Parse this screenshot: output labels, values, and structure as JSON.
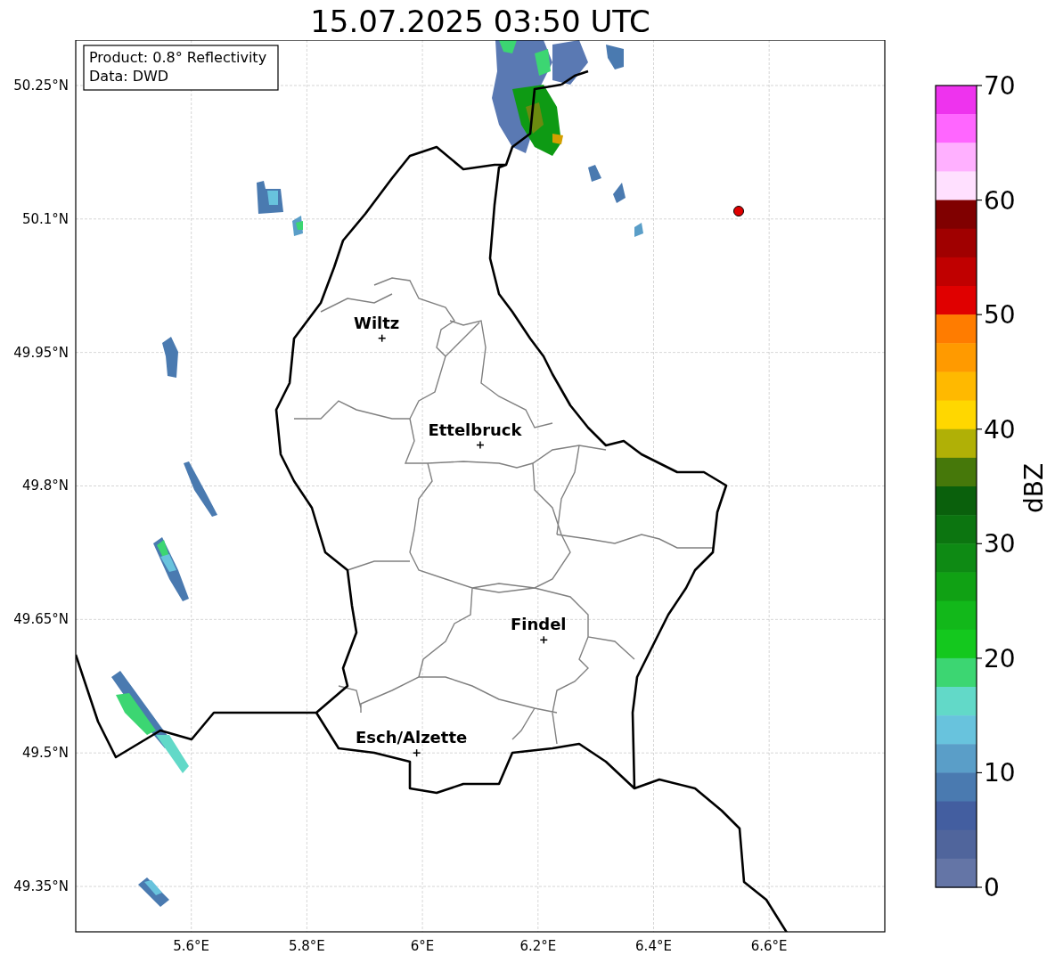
{
  "title": "15.07.2025 03:50 UTC",
  "info_box": {
    "lines": [
      "Product: 0.8° Reflectivity",
      "Data: DWD"
    ]
  },
  "map": {
    "y_ticks": [
      "50.25°N",
      "50.1°N",
      "49.95°N",
      "49.8°N",
      "49.65°N",
      "49.5°N",
      "49.35°N"
    ],
    "x_ticks": [
      "5.6°E",
      "5.8°E",
      "6°E",
      "6.2°E",
      "6.4°E",
      "6.6°E"
    ],
    "places": [
      {
        "name": "Wiltz"
      },
      {
        "name": "Ettelbruck"
      },
      {
        "name": "Findel"
      },
      {
        "name": "Esch/Alzette"
      }
    ]
  },
  "colorbar": {
    "label": "dBZ",
    "ticks": [
      "70",
      "60",
      "50",
      "40",
      "30",
      "20",
      "10",
      "0"
    ],
    "bins": [
      {
        "color": "#ee33ee"
      },
      {
        "color": "#ff66ff"
      },
      {
        "color": "#ffb0ff"
      },
      {
        "color": "#ffe0ff"
      },
      {
        "color": "#800000"
      },
      {
        "color": "#a00000"
      },
      {
        "color": "#c00000"
      },
      {
        "color": "#e00000"
      },
      {
        "color": "#ff7c00"
      },
      {
        "color": "#ff9a00"
      },
      {
        "color": "#ffb900"
      },
      {
        "color": "#ffd700"
      },
      {
        "color": "#b0b006"
      },
      {
        "color": "#46780a"
      },
      {
        "color": "#0a600c"
      },
      {
        "color": "#0c7510"
      },
      {
        "color": "#0e8a14"
      },
      {
        "color": "#10a114"
      },
      {
        "color": "#12b81a"
      },
      {
        "color": "#14c81e"
      },
      {
        "color": "#3cd672"
      },
      {
        "color": "#62d9c8"
      },
      {
        "color": "#68c3dd"
      },
      {
        "color": "#5a9ec8"
      },
      {
        "color": "#4a7ab0"
      },
      {
        "color": "#435ea0"
      },
      {
        "color": "#50659c"
      },
      {
        "color": "#6475a6"
      }
    ]
  }
}
